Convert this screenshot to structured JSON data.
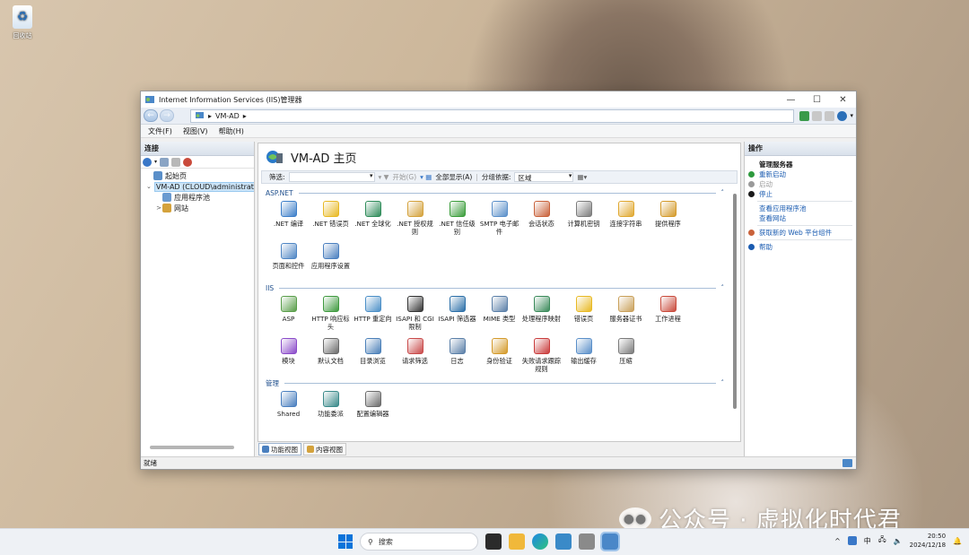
{
  "desktop": {
    "recycle_bin_label": "回收站",
    "watermark_text": "公众号 · 虚拟化时代君"
  },
  "window": {
    "title": "Internet Information Services (IIS)管理器",
    "controls": {
      "minimize": "—",
      "maximize": "☐",
      "close": "✕"
    },
    "address": {
      "separator1": "▸",
      "path": "VM-AD",
      "separator2": "▸"
    },
    "menu": [
      "文件(F)",
      "视图(V)",
      "帮助(H)"
    ]
  },
  "connections": {
    "header": "连接",
    "tree": [
      {
        "label": "起始页",
        "expander": "",
        "indent": 0
      },
      {
        "label": "VM-AD (CLOUD\\administrator)",
        "expander": "⌄",
        "indent": 0,
        "selected": true
      },
      {
        "label": "应用程序池",
        "expander": "",
        "indent": 1
      },
      {
        "label": "网站",
        "expander": ">",
        "indent": 1
      }
    ]
  },
  "main": {
    "title": "VM-AD 主页",
    "filter": {
      "label": "筛选:",
      "start_button": "开始(G)",
      "show_all_button": "全部显示(A)",
      "group_by_label": "分组依据:",
      "group_by_value": "区域"
    },
    "sections": [
      {
        "name": "ASP.NET",
        "features": [
          {
            "label": ".NET 编译",
            "icon": "net-compile-icon",
            "color": "#3d7fc9"
          },
          {
            "label": ".NET 错误页",
            "icon": "net-error-pages-icon",
            "color": "#e8b923"
          },
          {
            "label": ".NET 全球化",
            "icon": "net-globalization-icon",
            "color": "#2f8c5a"
          },
          {
            "label": ".NET 授权规则",
            "icon": "net-authorization-icon",
            "color": "#d4a23c"
          },
          {
            "label": ".NET 信任级别",
            "icon": "net-trust-levels-icon",
            "color": "#3b9d3b"
          },
          {
            "label": "SMTP 电子邮件",
            "icon": "smtp-email-icon",
            "color": "#5a8fc9"
          },
          {
            "label": "会话状态",
            "icon": "session-state-icon",
            "color": "#c9623b"
          },
          {
            "label": "计算机密钥",
            "icon": "machine-key-icon",
            "color": "#7b7b7b"
          },
          {
            "label": "连接字符串",
            "icon": "connection-strings-icon",
            "color": "#e0a830"
          },
          {
            "label": "提供程序",
            "icon": "providers-icon",
            "color": "#d49a2a"
          },
          {
            "label": "页面和控件",
            "icon": "pages-controls-icon",
            "color": "#4f86c4"
          },
          {
            "label": "应用程序设置",
            "icon": "app-settings-icon",
            "color": "#4a7fbf"
          }
        ]
      },
      {
        "name": "IIS",
        "features": [
          {
            "label": "ASP",
            "icon": "asp-icon",
            "color": "#5a9e4a"
          },
          {
            "label": "HTTP 响应标头",
            "icon": "http-response-headers-icon",
            "color": "#3f9a3f"
          },
          {
            "label": "HTTP 重定向",
            "icon": "http-redirect-icon",
            "color": "#4b8fc7"
          },
          {
            "label": "ISAPI 和 CGI 限制",
            "icon": "isapi-cgi-icon",
            "color": "#333333"
          },
          {
            "label": "ISAPI 筛选器",
            "icon": "isapi-filters-icon",
            "color": "#2b6fa8"
          },
          {
            "label": "MIME 类型",
            "icon": "mime-types-icon",
            "color": "#5a7fa8"
          },
          {
            "label": "处理程序映射",
            "icon": "handler-mappings-icon",
            "color": "#3a8a5a"
          },
          {
            "label": "错误页",
            "icon": "error-pages-icon",
            "color": "#e8b923"
          },
          {
            "label": "服务器证书",
            "icon": "server-certificates-icon",
            "color": "#c9a05a"
          },
          {
            "label": "工作进程",
            "icon": "worker-processes-icon",
            "color": "#c94a3b"
          },
          {
            "label": "模块",
            "icon": "modules-icon",
            "color": "#8a4ac9"
          },
          {
            "label": "默认文档",
            "icon": "default-document-icon",
            "color": "#6a6a6a"
          },
          {
            "label": "目录浏览",
            "icon": "directory-browsing-icon",
            "color": "#4a7fb8"
          },
          {
            "label": "请求筛选",
            "icon": "request-filtering-icon",
            "color": "#c94a4a"
          },
          {
            "label": "日志",
            "icon": "logging-icon",
            "color": "#5a7fa8"
          },
          {
            "label": "身份验证",
            "icon": "authentication-icon",
            "color": "#d49a2a"
          },
          {
            "label": "失败请求跟踪规则",
            "icon": "failed-request-tracing-icon",
            "color": "#c93b3b"
          },
          {
            "label": "输出缓存",
            "icon": "output-caching-icon",
            "color": "#5a8fc9"
          },
          {
            "label": "压缩",
            "icon": "compression-icon",
            "color": "#7a7a7a"
          }
        ]
      },
      {
        "name": "管理",
        "features": [
          {
            "label": "Shared",
            "icon": "shared-config-icon",
            "color": "#4a7fbf"
          },
          {
            "label": "功能委派",
            "icon": "feature-delegation-icon",
            "color": "#3a8a8a"
          },
          {
            "label": "配置编辑器",
            "icon": "configuration-editor-icon",
            "color": "#6a6a6a"
          }
        ]
      }
    ],
    "bottom_tabs": [
      "功能视图",
      "内容视图"
    ]
  },
  "actions": {
    "header": "操作",
    "items": [
      {
        "type": "header",
        "label": "管理服务器"
      },
      {
        "type": "link",
        "label": "重新启动",
        "icon": "restart-icon",
        "color": "#2e9a3e"
      },
      {
        "type": "disabled",
        "label": "启动",
        "icon": "start-icon",
        "color": "#9a9a9a"
      },
      {
        "type": "link",
        "label": "停止",
        "icon": "stop-icon",
        "color": "#1a1a1a"
      },
      {
        "type": "sep"
      },
      {
        "type": "link",
        "label": "查看应用程序池",
        "icon": "",
        "color": ""
      },
      {
        "type": "link",
        "label": "查看网站",
        "icon": "",
        "color": ""
      },
      {
        "type": "sep"
      },
      {
        "type": "link",
        "label": "获取新的 Web 平台组件",
        "icon": "web-platform-icon",
        "color": "#c9623b"
      },
      {
        "type": "sep"
      },
      {
        "type": "link",
        "label": "帮助",
        "icon": "help-icon",
        "color": "#1a5bb0"
      }
    ]
  },
  "status": {
    "text": "就绪"
  },
  "taskbar": {
    "search_placeholder": "搜索",
    "tray_language": "中",
    "tray_up": "^",
    "time": "20:50",
    "date": "2024/12/18"
  }
}
